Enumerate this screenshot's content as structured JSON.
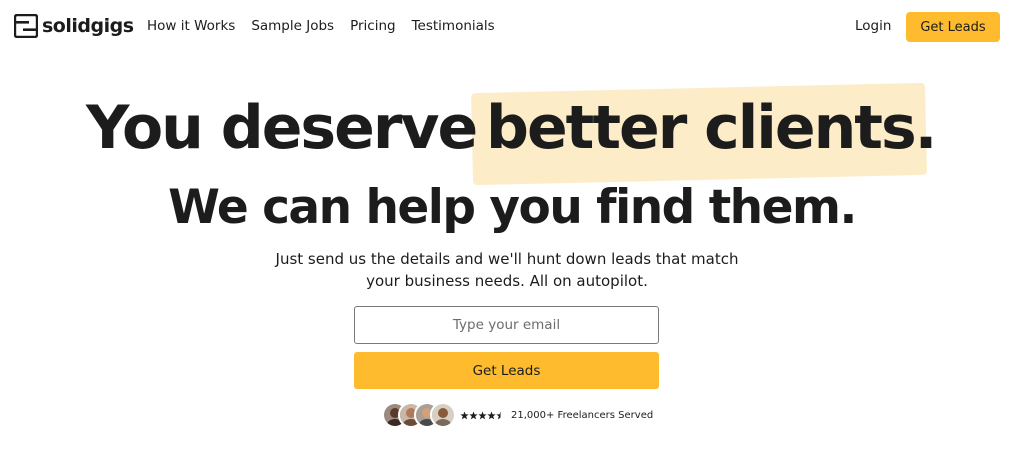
{
  "brand": {
    "name": "solidgigs"
  },
  "nav": {
    "links": [
      "How it Works",
      "Sample Jobs",
      "Pricing",
      "Testimonials"
    ],
    "login": "Login",
    "cta": "Get Leads"
  },
  "hero": {
    "headline_part1": "You deserve",
    "headline_highlight": "better clients.",
    "headline_line2": "We can help you find them.",
    "subtitle_line1": "Just send us the details and we'll hunt down leads that match",
    "subtitle_line2": "your business needs. All on autopilot.",
    "email_placeholder": "Type your email",
    "cta": "Get Leads"
  },
  "social_proof": {
    "rating": 4.5,
    "text": "21,000+ Freelancers Served"
  },
  "colors": {
    "accent": "#fdbb2d",
    "highlight": "#fdecc8",
    "text": "#1c1c1c"
  }
}
